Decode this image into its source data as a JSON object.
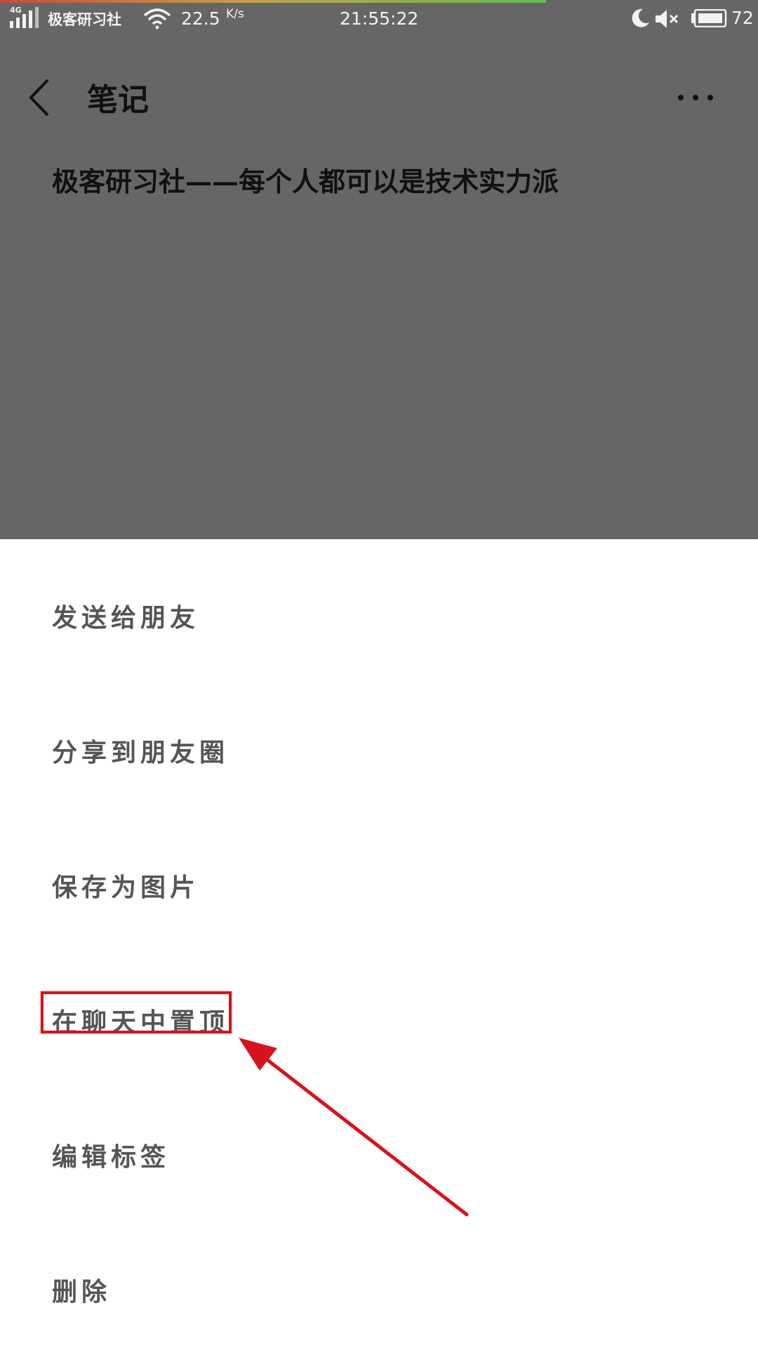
{
  "status_bar": {
    "network_tag": "4G",
    "carrier": "极客研习社",
    "speed": "22.5",
    "speed_unit": "K/s",
    "time": "21:55:22",
    "battery": "72"
  },
  "header": {
    "title": "笔记",
    "back_icon": "chevron-left-icon",
    "more_icon": "more-horizontal-icon"
  },
  "note": {
    "text": "极客研习社——每个人都可以是技术实力派"
  },
  "action_sheet": {
    "items": [
      {
        "label": "发送给朋友"
      },
      {
        "label": "分享到朋友圈"
      },
      {
        "label": "保存为图片"
      },
      {
        "label": "在聊天中置顶"
      },
      {
        "label": "编辑标签"
      },
      {
        "label": "删除"
      }
    ]
  },
  "colors": {
    "dim_overlay": "#666666",
    "annotation": "#d6131c",
    "menu_text": "#555555"
  }
}
